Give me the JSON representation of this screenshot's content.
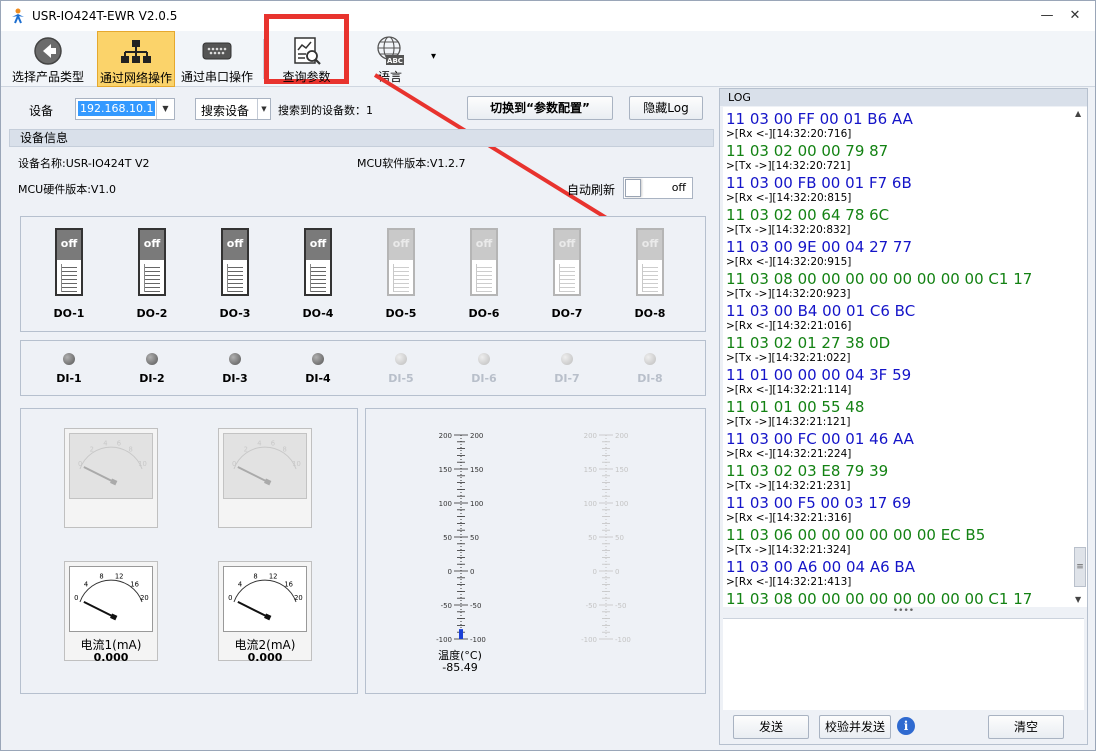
{
  "window": {
    "title": "USR-IO424T-EWR V2.0.5",
    "controls": {
      "minimize": "—",
      "close": "✕"
    }
  },
  "toolbar": {
    "items": [
      {
        "label": "选择产品类型",
        "icon": "back-arrow-icon"
      },
      {
        "label": "通过网络操作",
        "icon": "network-icon"
      },
      {
        "label": "通过串口操作",
        "icon": "serial-port-icon"
      },
      {
        "label": "查询参数",
        "icon": "query-chart-icon"
      },
      {
        "label": "语言",
        "icon": "globe-abc-icon"
      }
    ],
    "language_dropdown": "▾"
  },
  "device_bar": {
    "device_label": "设备",
    "ip_value": "192.168.10.1",
    "search_button": "搜索设备",
    "found_text": "搜索到的设备数：1",
    "switch_button": "切换到“参数配置”",
    "hide_log_button": "隐藏Log"
  },
  "device_info": {
    "header": "设备信息",
    "name": "设备名称:USR-IO424T V2",
    "mcu_sw": "MCU软件版本:V1.2.7",
    "mcu_hw": "MCU硬件版本:V1.0",
    "auto_refresh_label": "自动刷新",
    "auto_refresh_state": "off"
  },
  "do": [
    {
      "label": "DO-1",
      "state": "off",
      "enabled": true
    },
    {
      "label": "DO-2",
      "state": "off",
      "enabled": true
    },
    {
      "label": "DO-3",
      "state": "off",
      "enabled": true
    },
    {
      "label": "DO-4",
      "state": "off",
      "enabled": true
    },
    {
      "label": "DO-5",
      "state": "off",
      "enabled": false
    },
    {
      "label": "DO-6",
      "state": "off",
      "enabled": false
    },
    {
      "label": "DO-7",
      "state": "off",
      "enabled": false
    },
    {
      "label": "DO-8",
      "state": "off",
      "enabled": false
    }
  ],
  "di": [
    {
      "label": "DI-1",
      "enabled": true
    },
    {
      "label": "DI-2",
      "enabled": true
    },
    {
      "label": "DI-3",
      "enabled": true
    },
    {
      "label": "DI-4",
      "enabled": true
    },
    {
      "label": "DI-5",
      "enabled": false
    },
    {
      "label": "DI-6",
      "enabled": false
    },
    {
      "label": "DI-7",
      "enabled": false
    },
    {
      "label": "DI-8",
      "enabled": false
    }
  ],
  "meters": {
    "dim_scale": [
      "0",
      "2",
      "4",
      "6",
      "8",
      "10"
    ],
    "active_scale": [
      "0",
      "4",
      "8",
      "12",
      "16",
      "20"
    ],
    "current1": {
      "title": "电流1(mA)",
      "value": "0.000"
    },
    "current2": {
      "title": "电流2(mA)",
      "value": "0.000"
    }
  },
  "thermometer": {
    "ticks": [
      "200",
      "150",
      "100",
      "50",
      "0",
      "-50",
      "-100"
    ],
    "min": -100,
    "max": 200,
    "reading": -85.49,
    "title": "温度(°C)",
    "value": "-85.49"
  },
  "log": {
    "header": "LOG",
    "lines": [
      {
        "kind": "blue",
        "text": "11 03 00 FF 00 01 B6 AA"
      },
      {
        "kind": "rx",
        "text": ">[Rx <-][14:32:20:716]"
      },
      {
        "kind": "green",
        "text": "11 03 02 00 00 79 87"
      },
      {
        "kind": "tx",
        "text": ">[Tx ->][14:32:20:721]"
      },
      {
        "kind": "blue",
        "text": "11 03 00 FB 00 01 F7 6B"
      },
      {
        "kind": "rx",
        "text": ">[Rx <-][14:32:20:815]"
      },
      {
        "kind": "green",
        "text": "11 03 02 00 64 78 6C"
      },
      {
        "kind": "tx",
        "text": ">[Tx ->][14:32:20:832]"
      },
      {
        "kind": "blue",
        "text": "11 03 00 9E 00 04 27 77"
      },
      {
        "kind": "rx",
        "text": ">[Rx <-][14:32:20:915]"
      },
      {
        "kind": "green",
        "text": "11 03 08 00 00 00 00 00 00 00 00 C1 17"
      },
      {
        "kind": "tx",
        "text": ">[Tx ->][14:32:20:923]"
      },
      {
        "kind": "blue",
        "text": "11 03 00 B4 00 01 C6 BC"
      },
      {
        "kind": "rx",
        "text": ">[Rx <-][14:32:21:016]"
      },
      {
        "kind": "green",
        "text": "11 03 02 01 27 38 0D"
      },
      {
        "kind": "tx",
        "text": ">[Tx ->][14:32:21:022]"
      },
      {
        "kind": "blue",
        "text": "11 01 00 00 00 04 3F 59"
      },
      {
        "kind": "rx",
        "text": ">[Rx <-][14:32:21:114]"
      },
      {
        "kind": "green",
        "text": "11 01 01 00 55 48"
      },
      {
        "kind": "tx",
        "text": ">[Tx ->][14:32:21:121]"
      },
      {
        "kind": "blue",
        "text": "11 03 00 FC 00 01 46 AA"
      },
      {
        "kind": "rx",
        "text": ">[Rx <-][14:32:21:224]"
      },
      {
        "kind": "green",
        "text": "11 03 02 03 E8 79 39"
      },
      {
        "kind": "tx",
        "text": ">[Tx ->][14:32:21:231]"
      },
      {
        "kind": "blue",
        "text": "11 03 00 F5 00 03 17 69"
      },
      {
        "kind": "rx",
        "text": ">[Rx <-][14:32:21:316]"
      },
      {
        "kind": "green",
        "text": "11 03 06 00 00 00 00 00 00 EC B5"
      },
      {
        "kind": "tx",
        "text": ">[Tx ->][14:32:21:324]"
      },
      {
        "kind": "blue",
        "text": "11 03 00 A6 00 04 A6 BA"
      },
      {
        "kind": "rx",
        "text": ">[Rx <-][14:32:21:413]"
      },
      {
        "kind": "green",
        "text": "11 03 08 00 00 00 00 00 00 00 00 C1 17"
      }
    ],
    "send_button": "发送",
    "checksum_send_button": "校验并发送",
    "info_icon": "i",
    "clear_button": "清空",
    "splitter_grip": "••••"
  },
  "colors": {
    "highlight_red": "#e8332e",
    "active_tool": "#fbd36a",
    "log_blue": "#1414c8",
    "log_green": "#138213",
    "ip_selection": "#3399ff"
  }
}
